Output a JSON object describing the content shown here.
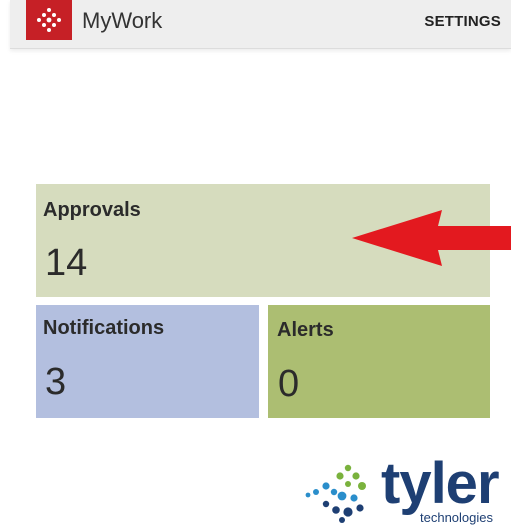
{
  "app": {
    "title": "MyWork",
    "logo_icon": "dots-logo-icon",
    "accent_color": "#c62026",
    "settings_label": "SETTINGS"
  },
  "tiles": [
    {
      "label": "Approvals",
      "count": "14",
      "color": "#d6dcbe"
    },
    {
      "label": "Notifications",
      "count": "3",
      "color": "#b3bfdf"
    },
    {
      "label": "Alerts",
      "count": "0",
      "color": "#acbe72"
    }
  ],
  "annotation": {
    "icon": "red-arrow-icon",
    "color": "#e3191f"
  },
  "brand": {
    "icon": "tyler-dots-logo-icon",
    "name": "tyler",
    "tagline": "technologies",
    "color": "#1e3f73"
  }
}
